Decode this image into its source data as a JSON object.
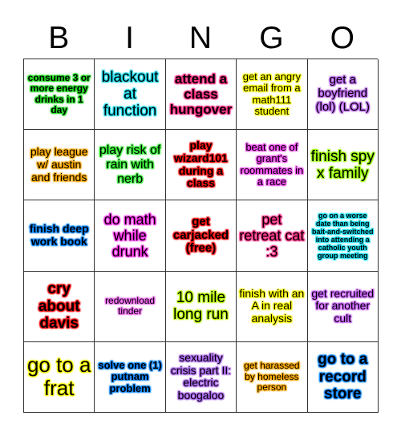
{
  "header": {
    "letters": [
      "B",
      "I",
      "N",
      "G",
      "O"
    ]
  },
  "cells": [
    {
      "text": "consume 3 or more energy drinks in 1 day",
      "glow": "#22dd22",
      "size": 12,
      "bold": true
    },
    {
      "text": "blackout at function",
      "glow": "#22ddee",
      "size": 19,
      "bold": false
    },
    {
      "text": "attend a class hungover",
      "glow": "#ff3388",
      "size": 17,
      "bold": true
    },
    {
      "text": "get an angry email from a math111 student",
      "glow": "#ffff00",
      "size": 13,
      "bold": false
    },
    {
      "text": "get a boyfriend (lol) (LOL)",
      "glow": "#bb66ee",
      "size": 15,
      "bold": false
    },
    {
      "text": "play league w/ austin and friends",
      "glow": "#ffaa00",
      "size": 14,
      "bold": false
    },
    {
      "text": "play risk of rain with nerb",
      "glow": "#33ee33",
      "size": 16,
      "bold": false
    },
    {
      "text": "play wizard101 during a class",
      "glow": "#ff1111",
      "size": 14,
      "bold": true
    },
    {
      "text": "beat one of grant's roommates in a race",
      "glow": "#ee44ee",
      "size": 13,
      "bold": false
    },
    {
      "text": "finish spy x family",
      "glow": "#99ff00",
      "size": 19,
      "bold": false
    },
    {
      "text": "finish deep work book",
      "glow": "#1188ff",
      "size": 14,
      "bold": true
    },
    {
      "text": "do math while drunk",
      "glow": "#ff33ee",
      "size": 18,
      "bold": false
    },
    {
      "text": "get carjacked (free)",
      "glow": "#ff1111",
      "size": 15,
      "bold": true
    },
    {
      "text": "pet retreat cat :3",
      "glow": "#ff3388",
      "size": 18,
      "bold": false
    },
    {
      "text": "go on a worse date than being bait-and-switched into attending a catholic youth group meeting",
      "glow": "#11ddee",
      "size": 9,
      "bold": true
    },
    {
      "text": "cry about davis",
      "glow": "#ff1111",
      "size": 19,
      "bold": true
    },
    {
      "text": "redownload tinder",
      "glow": "#ee66ee",
      "size": 12,
      "bold": false
    },
    {
      "text": "10 mile long run",
      "glow": "#bbff00",
      "size": 19,
      "bold": false
    },
    {
      "text": "finish with an A in real analysis",
      "glow": "#ffff00",
      "size": 14,
      "bold": false
    },
    {
      "text": "get recruited for another cult",
      "glow": "#cc66ff",
      "size": 14,
      "bold": false
    },
    {
      "text": "go to a frat",
      "glow": "#ffff00",
      "size": 26,
      "bold": false
    },
    {
      "text": "solve one (1) putnam problem",
      "glow": "#1188ff",
      "size": 13,
      "bold": true
    },
    {
      "text": "sexuality crisis part II: electric boogaloo",
      "glow": "#aa66ee",
      "size": 14,
      "bold": false
    },
    {
      "text": "get harassed by homeless person",
      "glow": "#ffaa00",
      "size": 12,
      "bold": false
    },
    {
      "text": "go to a record store",
      "glow": "#1188ff",
      "size": 19,
      "bold": true
    }
  ]
}
